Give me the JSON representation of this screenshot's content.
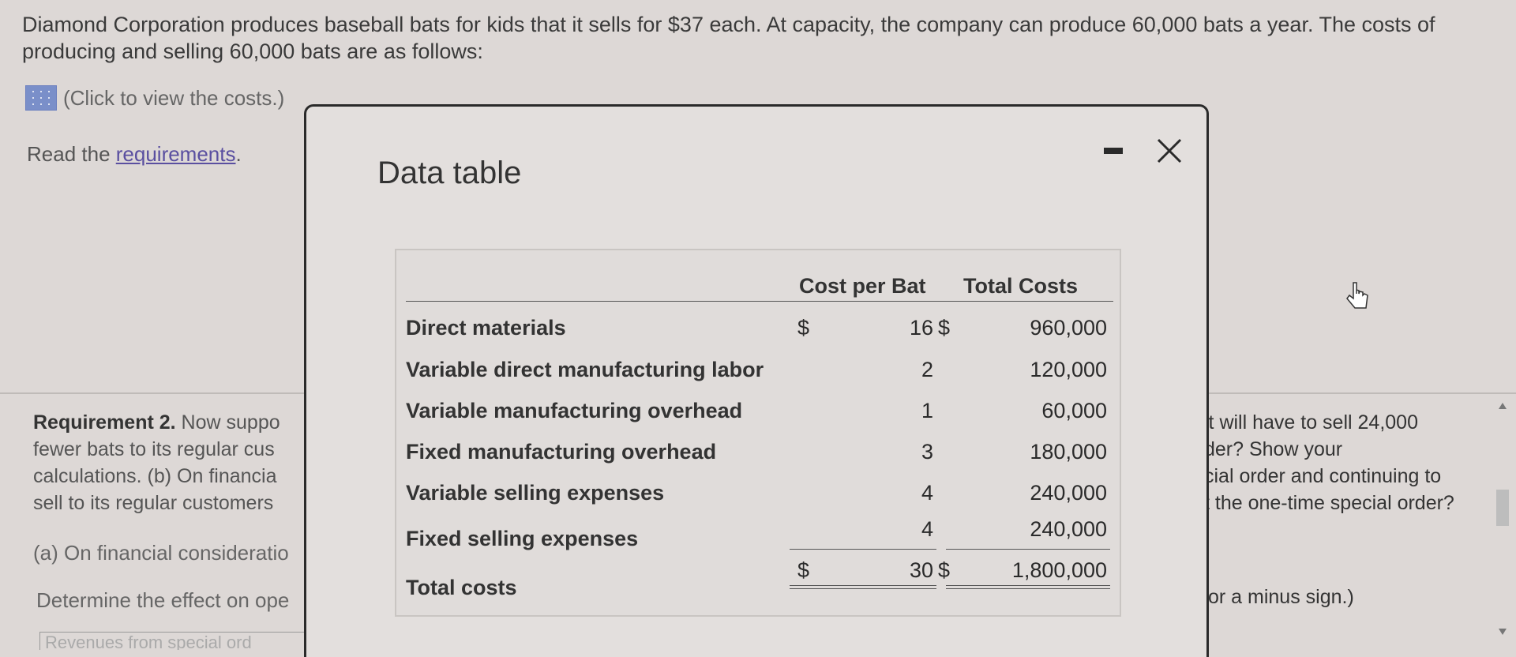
{
  "intro": "Diamond Corporation produces baseball bats for kids that it sells for $37 each. At capacity, the company can produce 60,000 bats a year. The costs of producing and selling 60,000 bats are as follows:",
  "click_link": "(Click to view the costs.)",
  "read_prefix": "Read the ",
  "read_link": "requirements",
  "read_suffix": ".",
  "req2": {
    "bold": "Requirement 2.",
    "line1": " Now suppo",
    "line2": "fewer bats to its regular cus",
    "line3": "calculations. (b) On financia",
    "line4": "sell to its regular customers"
  },
  "part_a": "(a) On financial consideratio",
  "determine": "Determine the effect on ope",
  "revenues_row": "Revenues from special ord",
  "right_text": {
    "line1": "it will have to sell 24,000",
    "line2": "der? Show your",
    "line3": "cial order and continuing to",
    "line4": "t the one-time special order?"
  },
  "right_minus": "or a minus sign.)",
  "modal": {
    "title": "Data table",
    "col_cost_per_bat": "Cost per Bat",
    "col_total_costs": "Total Costs",
    "rows": [
      {
        "label": "Direct materials",
        "cur1": "$",
        "per_bat": "16",
        "cur2": "$",
        "total": "960,000"
      },
      {
        "label": "Variable direct manufacturing labor",
        "cur1": "",
        "per_bat": "2",
        "cur2": "",
        "total": "120,000"
      },
      {
        "label": "Variable manufacturing overhead",
        "cur1": "",
        "per_bat": "1",
        "cur2": "",
        "total": "60,000"
      },
      {
        "label": "Fixed manufacturing overhead",
        "cur1": "",
        "per_bat": "3",
        "cur2": "",
        "total": "180,000"
      },
      {
        "label": "Variable selling expenses",
        "cur1": "",
        "per_bat": "4",
        "cur2": "",
        "total": "240,000"
      },
      {
        "label": "Fixed selling expenses",
        "cur1": "",
        "per_bat": "4",
        "cur2": "",
        "total": "240,000"
      }
    ],
    "total_row": {
      "label": "Total costs",
      "cur1": "$",
      "per_bat": "30",
      "cur2": "$",
      "total": "1,800,000"
    }
  }
}
